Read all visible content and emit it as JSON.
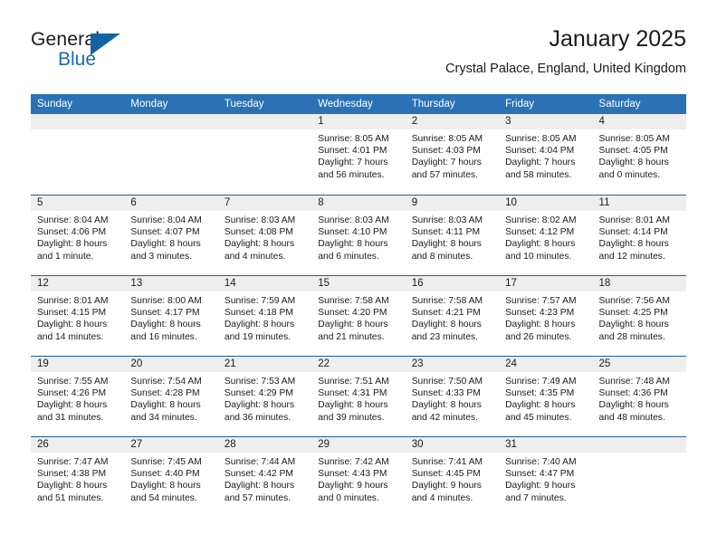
{
  "brand": {
    "name_part1": "General",
    "name_part2": "Blue",
    "logo_icon": "triangle-logo-icon"
  },
  "header": {
    "title": "January 2025",
    "location": "Crystal Palace, England, United Kingdom"
  },
  "colors": {
    "header_bar": "#2a72b5",
    "row_divider": "#1f5fa0",
    "daynum_bar": "#eeeeee",
    "brand_blue": "#1b6cb3",
    "text": "#1a1a1a"
  },
  "weekdays": [
    "Sunday",
    "Monday",
    "Tuesday",
    "Wednesday",
    "Thursday",
    "Friday",
    "Saturday"
  ],
  "weeks": [
    [
      {
        "day": "",
        "sunrise": "",
        "sunset": "",
        "daylight1": "",
        "daylight2": "",
        "empty": true
      },
      {
        "day": "",
        "sunrise": "",
        "sunset": "",
        "daylight1": "",
        "daylight2": "",
        "empty": true
      },
      {
        "day": "",
        "sunrise": "",
        "sunset": "",
        "daylight1": "",
        "daylight2": "",
        "empty": true
      },
      {
        "day": "1",
        "sunrise": "Sunrise: 8:05 AM",
        "sunset": "Sunset: 4:01 PM",
        "daylight1": "Daylight: 7 hours",
        "daylight2": "and 56 minutes."
      },
      {
        "day": "2",
        "sunrise": "Sunrise: 8:05 AM",
        "sunset": "Sunset: 4:03 PM",
        "daylight1": "Daylight: 7 hours",
        "daylight2": "and 57 minutes."
      },
      {
        "day": "3",
        "sunrise": "Sunrise: 8:05 AM",
        "sunset": "Sunset: 4:04 PM",
        "daylight1": "Daylight: 7 hours",
        "daylight2": "and 58 minutes."
      },
      {
        "day": "4",
        "sunrise": "Sunrise: 8:05 AM",
        "sunset": "Sunset: 4:05 PM",
        "daylight1": "Daylight: 8 hours",
        "daylight2": "and 0 minutes."
      }
    ],
    [
      {
        "day": "5",
        "sunrise": "Sunrise: 8:04 AM",
        "sunset": "Sunset: 4:06 PM",
        "daylight1": "Daylight: 8 hours",
        "daylight2": "and 1 minute."
      },
      {
        "day": "6",
        "sunrise": "Sunrise: 8:04 AM",
        "sunset": "Sunset: 4:07 PM",
        "daylight1": "Daylight: 8 hours",
        "daylight2": "and 3 minutes."
      },
      {
        "day": "7",
        "sunrise": "Sunrise: 8:03 AM",
        "sunset": "Sunset: 4:08 PM",
        "daylight1": "Daylight: 8 hours",
        "daylight2": "and 4 minutes."
      },
      {
        "day": "8",
        "sunrise": "Sunrise: 8:03 AM",
        "sunset": "Sunset: 4:10 PM",
        "daylight1": "Daylight: 8 hours",
        "daylight2": "and 6 minutes."
      },
      {
        "day": "9",
        "sunrise": "Sunrise: 8:03 AM",
        "sunset": "Sunset: 4:11 PM",
        "daylight1": "Daylight: 8 hours",
        "daylight2": "and 8 minutes."
      },
      {
        "day": "10",
        "sunrise": "Sunrise: 8:02 AM",
        "sunset": "Sunset: 4:12 PM",
        "daylight1": "Daylight: 8 hours",
        "daylight2": "and 10 minutes."
      },
      {
        "day": "11",
        "sunrise": "Sunrise: 8:01 AM",
        "sunset": "Sunset: 4:14 PM",
        "daylight1": "Daylight: 8 hours",
        "daylight2": "and 12 minutes."
      }
    ],
    [
      {
        "day": "12",
        "sunrise": "Sunrise: 8:01 AM",
        "sunset": "Sunset: 4:15 PM",
        "daylight1": "Daylight: 8 hours",
        "daylight2": "and 14 minutes."
      },
      {
        "day": "13",
        "sunrise": "Sunrise: 8:00 AM",
        "sunset": "Sunset: 4:17 PM",
        "daylight1": "Daylight: 8 hours",
        "daylight2": "and 16 minutes."
      },
      {
        "day": "14",
        "sunrise": "Sunrise: 7:59 AM",
        "sunset": "Sunset: 4:18 PM",
        "daylight1": "Daylight: 8 hours",
        "daylight2": "and 19 minutes."
      },
      {
        "day": "15",
        "sunrise": "Sunrise: 7:58 AM",
        "sunset": "Sunset: 4:20 PM",
        "daylight1": "Daylight: 8 hours",
        "daylight2": "and 21 minutes."
      },
      {
        "day": "16",
        "sunrise": "Sunrise: 7:58 AM",
        "sunset": "Sunset: 4:21 PM",
        "daylight1": "Daylight: 8 hours",
        "daylight2": "and 23 minutes."
      },
      {
        "day": "17",
        "sunrise": "Sunrise: 7:57 AM",
        "sunset": "Sunset: 4:23 PM",
        "daylight1": "Daylight: 8 hours",
        "daylight2": "and 26 minutes."
      },
      {
        "day": "18",
        "sunrise": "Sunrise: 7:56 AM",
        "sunset": "Sunset: 4:25 PM",
        "daylight1": "Daylight: 8 hours",
        "daylight2": "and 28 minutes."
      }
    ],
    [
      {
        "day": "19",
        "sunrise": "Sunrise: 7:55 AM",
        "sunset": "Sunset: 4:26 PM",
        "daylight1": "Daylight: 8 hours",
        "daylight2": "and 31 minutes."
      },
      {
        "day": "20",
        "sunrise": "Sunrise: 7:54 AM",
        "sunset": "Sunset: 4:28 PM",
        "daylight1": "Daylight: 8 hours",
        "daylight2": "and 34 minutes."
      },
      {
        "day": "21",
        "sunrise": "Sunrise: 7:53 AM",
        "sunset": "Sunset: 4:29 PM",
        "daylight1": "Daylight: 8 hours",
        "daylight2": "and 36 minutes."
      },
      {
        "day": "22",
        "sunrise": "Sunrise: 7:51 AM",
        "sunset": "Sunset: 4:31 PM",
        "daylight1": "Daylight: 8 hours",
        "daylight2": "and 39 minutes."
      },
      {
        "day": "23",
        "sunrise": "Sunrise: 7:50 AM",
        "sunset": "Sunset: 4:33 PM",
        "daylight1": "Daylight: 8 hours",
        "daylight2": "and 42 minutes."
      },
      {
        "day": "24",
        "sunrise": "Sunrise: 7:49 AM",
        "sunset": "Sunset: 4:35 PM",
        "daylight1": "Daylight: 8 hours",
        "daylight2": "and 45 minutes."
      },
      {
        "day": "25",
        "sunrise": "Sunrise: 7:48 AM",
        "sunset": "Sunset: 4:36 PM",
        "daylight1": "Daylight: 8 hours",
        "daylight2": "and 48 minutes."
      }
    ],
    [
      {
        "day": "26",
        "sunrise": "Sunrise: 7:47 AM",
        "sunset": "Sunset: 4:38 PM",
        "daylight1": "Daylight: 8 hours",
        "daylight2": "and 51 minutes."
      },
      {
        "day": "27",
        "sunrise": "Sunrise: 7:45 AM",
        "sunset": "Sunset: 4:40 PM",
        "daylight1": "Daylight: 8 hours",
        "daylight2": "and 54 minutes."
      },
      {
        "day": "28",
        "sunrise": "Sunrise: 7:44 AM",
        "sunset": "Sunset: 4:42 PM",
        "daylight1": "Daylight: 8 hours",
        "daylight2": "and 57 minutes."
      },
      {
        "day": "29",
        "sunrise": "Sunrise: 7:42 AM",
        "sunset": "Sunset: 4:43 PM",
        "daylight1": "Daylight: 9 hours",
        "daylight2": "and 0 minutes."
      },
      {
        "day": "30",
        "sunrise": "Sunrise: 7:41 AM",
        "sunset": "Sunset: 4:45 PM",
        "daylight1": "Daylight: 9 hours",
        "daylight2": "and 4 minutes."
      },
      {
        "day": "31",
        "sunrise": "Sunrise: 7:40 AM",
        "sunset": "Sunset: 4:47 PM",
        "daylight1": "Daylight: 9 hours",
        "daylight2": "and 7 minutes."
      },
      {
        "day": "",
        "sunrise": "",
        "sunset": "",
        "daylight1": "",
        "daylight2": "",
        "empty": true
      }
    ]
  ]
}
